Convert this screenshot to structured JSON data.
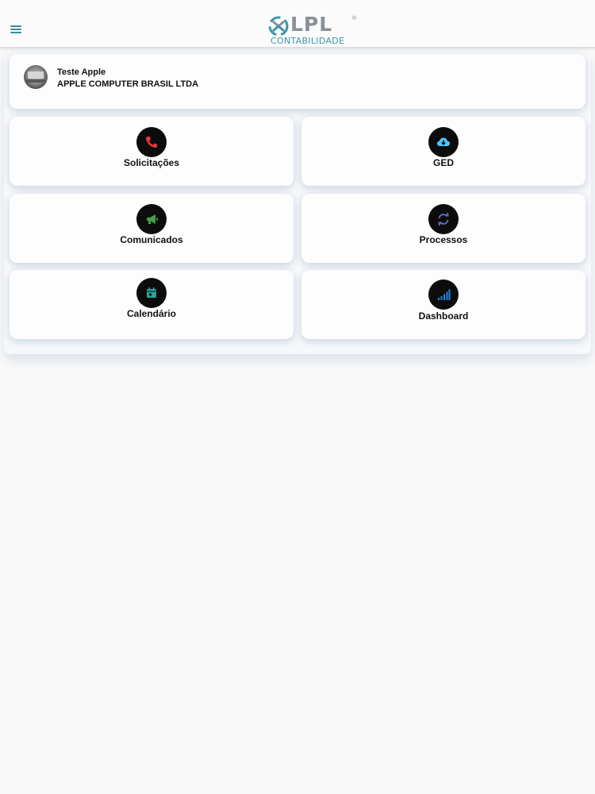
{
  "header": {
    "logo_text": "LPL",
    "logo_subtitle": "CONTABILIDADE",
    "logo_reg": "®"
  },
  "user": {
    "name": "Teste Apple",
    "company": "APPLE COMPUTER BRASIL LTDA"
  },
  "tiles": [
    {
      "label": "Solicitações",
      "icon": "phone-icon",
      "color": "#e53935"
    },
    {
      "label": "GED",
      "icon": "cloud-download-icon",
      "color": "#4fc3f7"
    },
    {
      "label": "Comunicados",
      "icon": "megaphone-icon",
      "color": "#43a047"
    },
    {
      "label": "Processos",
      "icon": "sync-icon",
      "color": "#5c6bc0"
    },
    {
      "label": "Calendário",
      "icon": "calendar-icon",
      "color": "#26a69a"
    },
    {
      "label": "Dashboard",
      "icon": "signal-bars-icon",
      "color": "#1e88e5"
    }
  ],
  "colors": {
    "accent": "#3a8d9c",
    "background": "#f9f9f9",
    "card": "#fdfdfd",
    "icon_bg": "#0c0c0c"
  }
}
